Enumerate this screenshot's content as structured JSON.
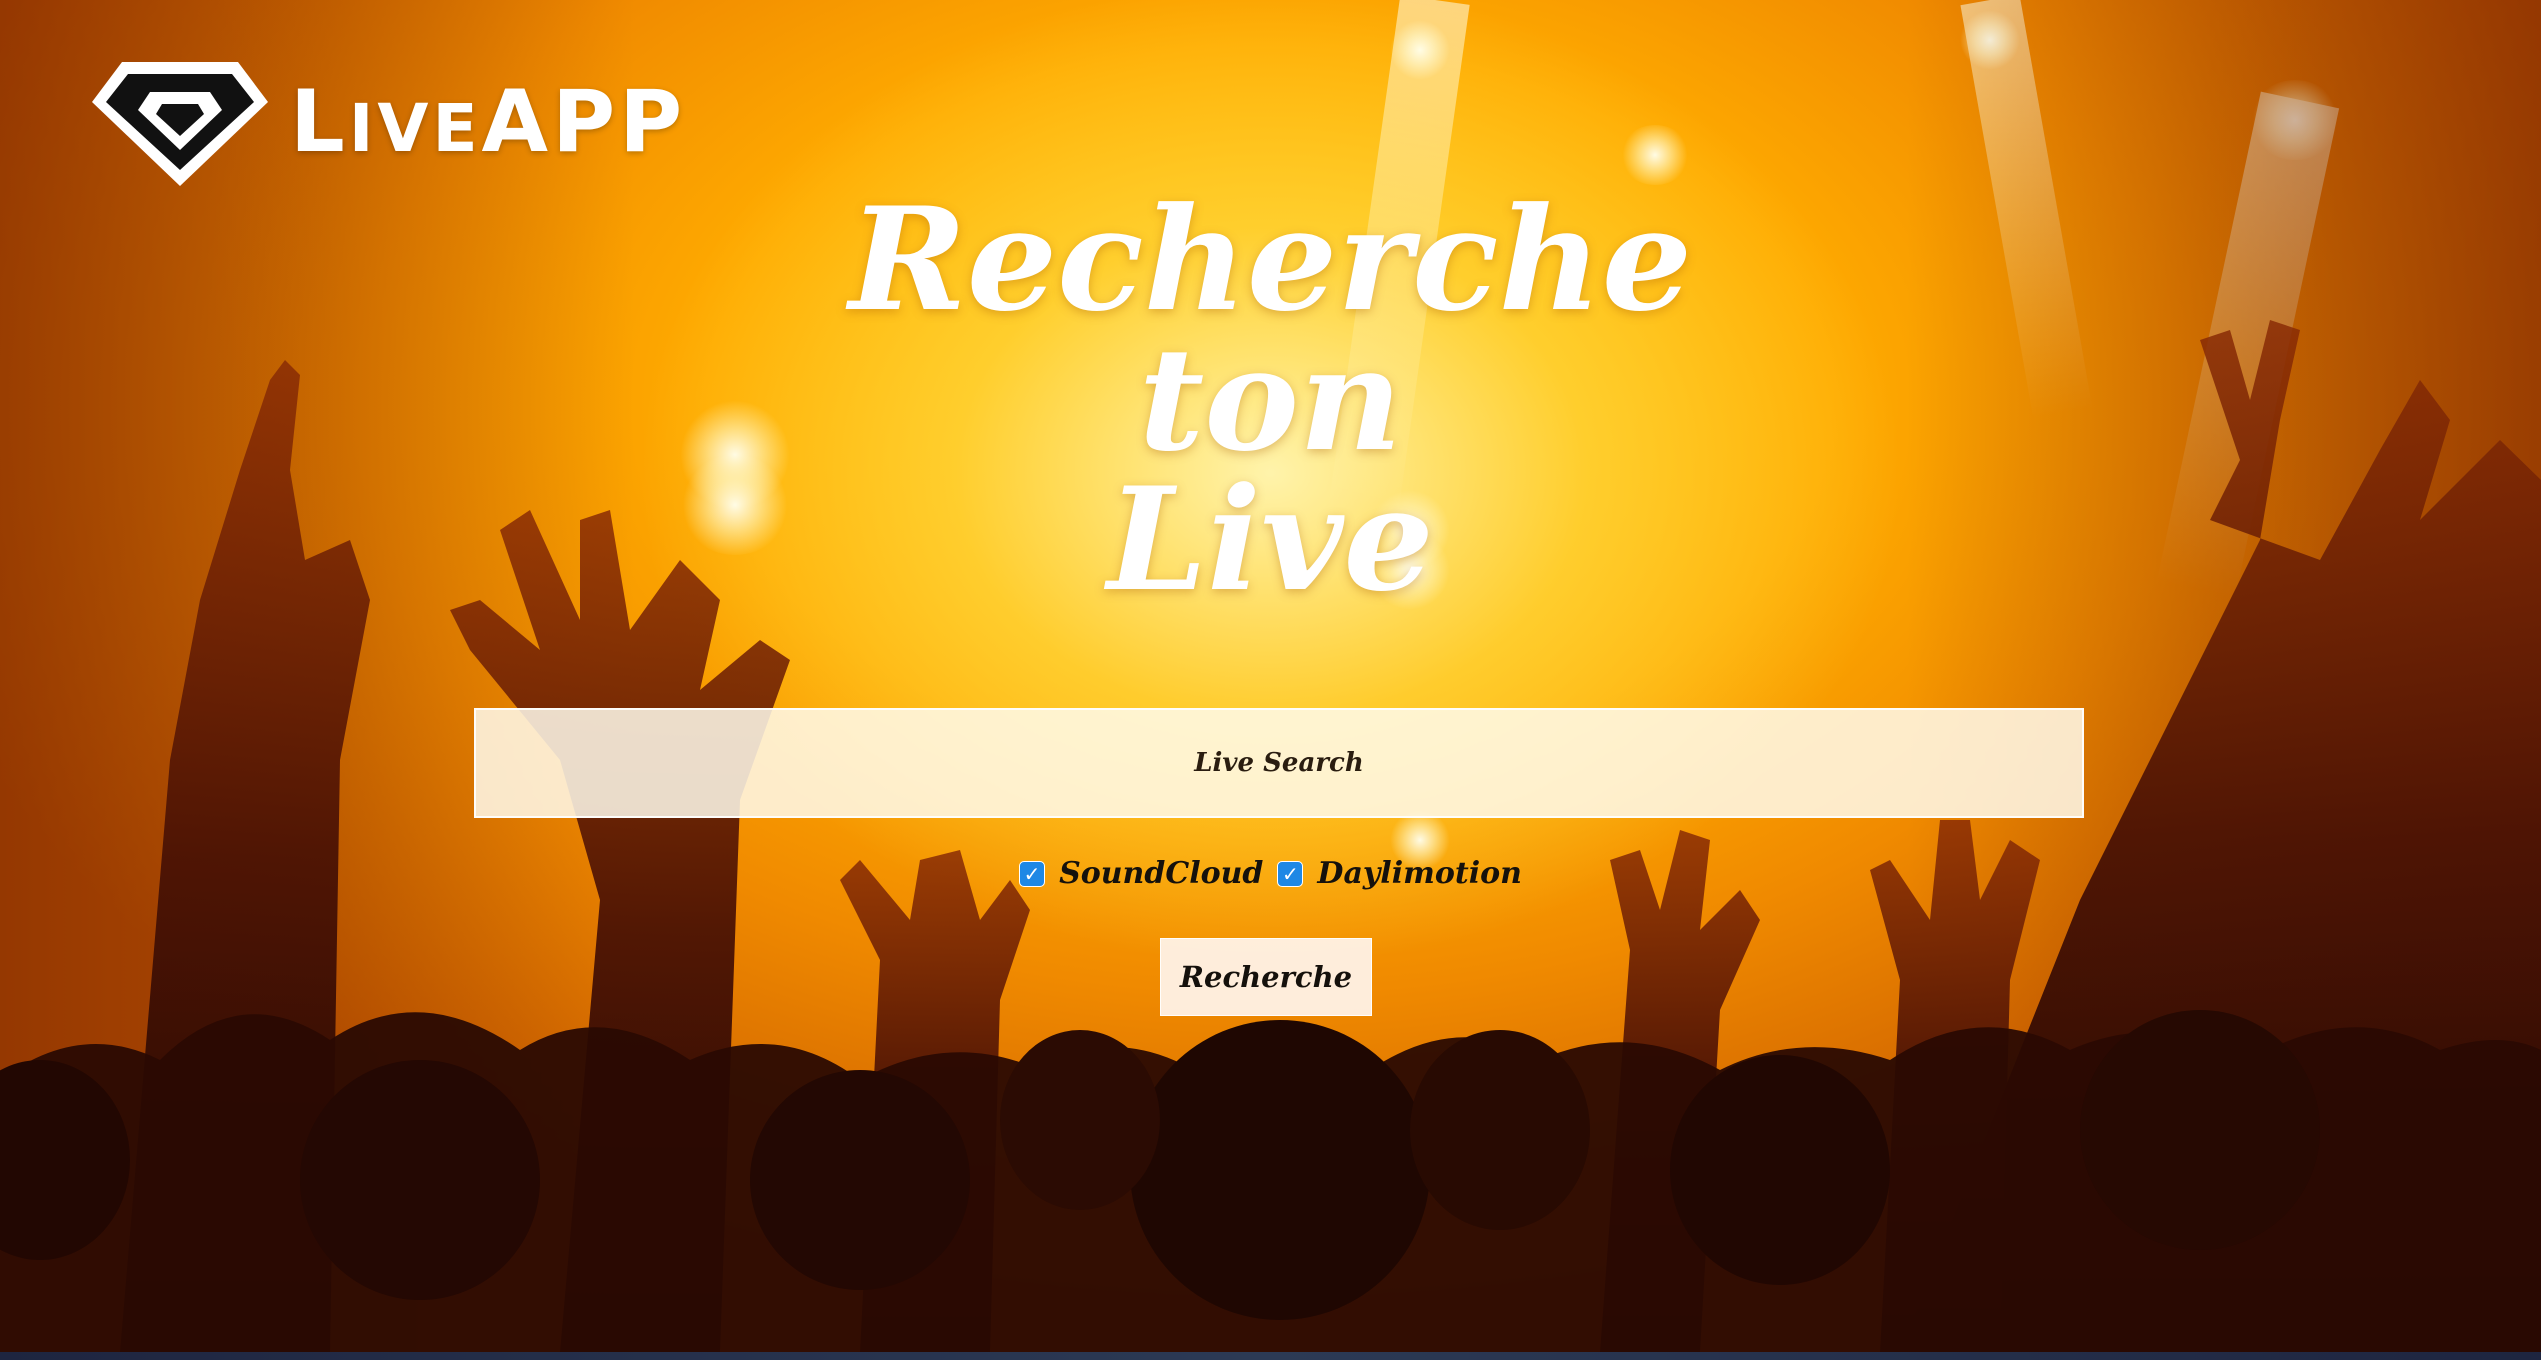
{
  "brand": {
    "name_first_letter": "L",
    "name_small": "IVE",
    "name_rest": "APP"
  },
  "headline": {
    "line1": "Recherche",
    "line2": "ton",
    "line3": "Live"
  },
  "search": {
    "placeholder": "Live Search",
    "value": ""
  },
  "sources": [
    {
      "label": "SoundCloud",
      "checked": true
    },
    {
      "label": "Daylimotion",
      "checked": true
    }
  ],
  "submit": {
    "label": "Recherche"
  },
  "colors": {
    "checkbox": "#1e88e5",
    "background_warm": "#ffb300"
  }
}
